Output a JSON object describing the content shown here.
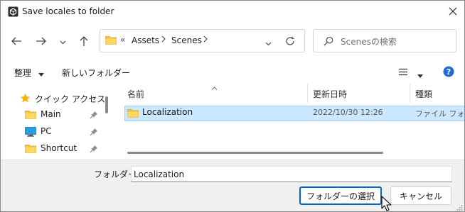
{
  "window": {
    "title": "Save locales to folder",
    "icon": "unity-logo-icon"
  },
  "nav": {
    "back_icon": "arrow-left-icon",
    "forward_icon": "arrow-right-icon",
    "recent_icon": "chevron-down-icon",
    "up_icon": "arrow-up-icon",
    "breadcrumb_prefix": "«",
    "breadcrumb": [
      "Assets",
      "Scenes"
    ],
    "refresh_icon": "refresh-icon",
    "search_placeholder": "Scenesの検索"
  },
  "commands": {
    "organize": "整理",
    "new_folder": "新しいフォルダー",
    "view_icon": "view-list-icon",
    "help_icon": "help-icon"
  },
  "sidebar": {
    "quick_access": "クイック アクセス",
    "items": [
      {
        "label": "Main",
        "icon": "folder-icon",
        "pinned": true
      },
      {
        "label": "PC",
        "icon": "pc-icon",
        "pinned": true
      },
      {
        "label": "Shortcut",
        "icon": "folder-icon",
        "pinned": true
      }
    ]
  },
  "filelist": {
    "columns": [
      "名前",
      "更新日時",
      "種類"
    ],
    "rows": [
      {
        "name": "Localization",
        "modified": "2022/10/30 12:26",
        "type": "ファイル フォルダー",
        "selected": true
      }
    ]
  },
  "footer": {
    "folder_label": "フォルダー:",
    "folder_value": "Localization",
    "select_button": "フォルダーの選択",
    "cancel_button": "キャンセル"
  },
  "colors": {
    "accent": "#0067c0",
    "selection": "#cce8ff",
    "folder": "#f5c242",
    "help": "#1e6fd0"
  }
}
